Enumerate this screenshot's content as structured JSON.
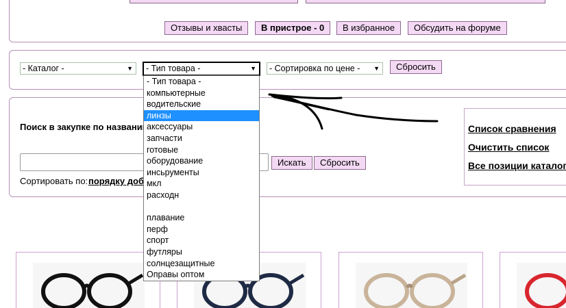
{
  "top_tabs": [
    {
      "label": "Отзывы и хвасты"
    },
    {
      "label": "В пристрое - 0"
    },
    {
      "label": "В избранное"
    },
    {
      "label": "Обсудить на форуме"
    }
  ],
  "filters": {
    "catalog": "- Каталог -",
    "type": "- Тип товара -",
    "sort": "- Сортировка по цене -",
    "reset_label": "Сбросить"
  },
  "dropdown_options": [
    "- Тип товара -",
    "компьютерные",
    "водительские",
    "линзы",
    "аксессуары",
    "запчасти",
    "готовые",
    "оборудование",
    "инсьрументы",
    "мкл",
    "расходн",
    "",
    "плавание",
    "перф",
    "спорт",
    "футляры",
    "солнцезащитные",
    "Оправы оптом"
  ],
  "selected_option": "линзы",
  "search": {
    "title": "Поиск в закупке по названию",
    "search_label": "Искать",
    "reset_label": "Сбросить",
    "sort_by_label": "Сортировать по:",
    "sort_by_value": "порядку добавления"
  },
  "right_links": [
    "Список сравнения",
    "Очистить список",
    "Все позиции каталога"
  ],
  "colors": {
    "button_bg": "#f4d9f5",
    "panel_border": "#b590b8",
    "selection": "#1e90ff"
  }
}
